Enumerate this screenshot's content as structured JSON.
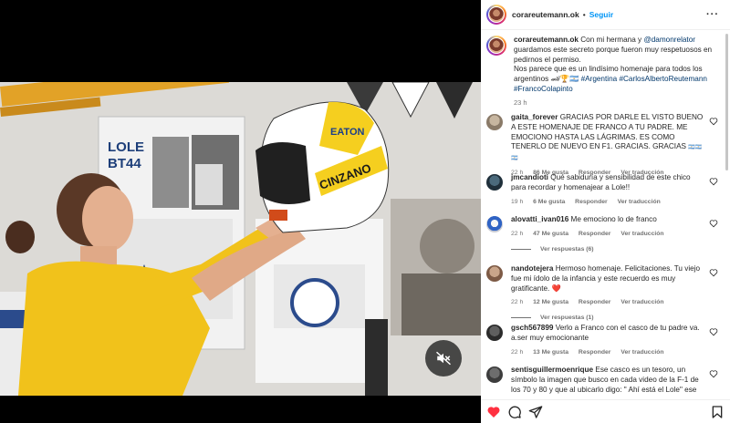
{
  "header": {
    "username": "corareutemann.ok",
    "separator": "•",
    "follow_label": "Seguir",
    "more_label": "···"
  },
  "caption": {
    "username": "corareutemann.ok",
    "mention": "@damonrelator",
    "text_1": " Con mi hermana y ",
    "text_2": " guardamos este secreto porque fueron muy respetuosos en pedirnos el permiso.",
    "text_3": "Nos parece que es un lindísimo homenaje para todos los argentinos 🏎🏆🇦🇷 ",
    "hashtags": "#Argentina #CarlosAlbertoReutemann #FrancoColapinto",
    "time": "23 h"
  },
  "comments": [
    {
      "username": "gaita_forever",
      "text": " GRACIAS POR DARLE EL VISTO BUENO A ESTE HOMENAJE DE FRANCO A TU PADRE. ME EMOCIONO HASTA LAS LÁGRIMAS. ES COMO TENERLO DE NUEVO EN F1. GRACIAS. GRACIAS",
      "emoji": "🇦🇷🇦🇷🇦🇷",
      "time": "22 h",
      "likes": "86 Me gusta",
      "reply": "Responder",
      "translate": "Ver traducción",
      "replies": ""
    },
    {
      "username": "jmcandioti",
      "text": " Qué sabiduría y sensibilidad de este chico para recordar y homenajear a Lole!!",
      "emoji": "",
      "time": "19 h",
      "likes": "6 Me gusta",
      "reply": "Responder",
      "translate": "Ver traducción",
      "replies": ""
    },
    {
      "username": "alovatti_ivan016",
      "text": " Me emociono lo de franco",
      "emoji": "",
      "time": "22 h",
      "likes": "47 Me gusta",
      "reply": "Responder",
      "translate": "Ver traducción",
      "replies": "Ver respuestas (6)"
    },
    {
      "username": "nandotejera",
      "text": " Hermoso homenaje. Felicitaciones. Tu viejo fue mi ídolo de la infancia y este recuerdo es muy gratificante.",
      "emoji": "❤️",
      "time": "22 h",
      "likes": "12 Me gusta",
      "reply": "Responder",
      "translate": "Ver traducción",
      "replies": "Ver respuestas (1)"
    },
    {
      "username": "gsch567899",
      "text": " Verlo a Franco con el casco de tu padre va. a.ser muy emocionante",
      "emoji": "",
      "time": "22 h",
      "likes": "13 Me gusta",
      "reply": "Responder",
      "translate": "Ver traducción",
      "replies": ""
    },
    {
      "username": "sentisguillermoenrique",
      "text": " Ese casco es un tesoro, un símbolo la imagen que busco en cada video de la F-1 de los 70 y 80 y que al ubicarlo digo: \" Ahí está el Lole\" ese casco no es otro BELL cualquiera, es de Carlos A. Reutemann. ÚNICOS LOS DOS!!",
      "emoji": "",
      "time": "",
      "likes": "",
      "reply": "",
      "translate": "",
      "replies": ""
    }
  ],
  "media": {
    "poster_title": "LOLE",
    "poster_model": "BT44",
    "helmet_brand": "EATON",
    "helmet_sponsor": "CINZANO",
    "mute_icon": "speaker-muted-icon"
  },
  "actions": {
    "like_icon": "heart-filled-icon",
    "comment_icon": "comment-icon",
    "share_icon": "share-icon",
    "save_icon": "bookmark-icon"
  },
  "colors": {
    "follow_blue": "#0095f6",
    "like_red": "#ff3040",
    "hashtag_blue": "#00376b"
  }
}
